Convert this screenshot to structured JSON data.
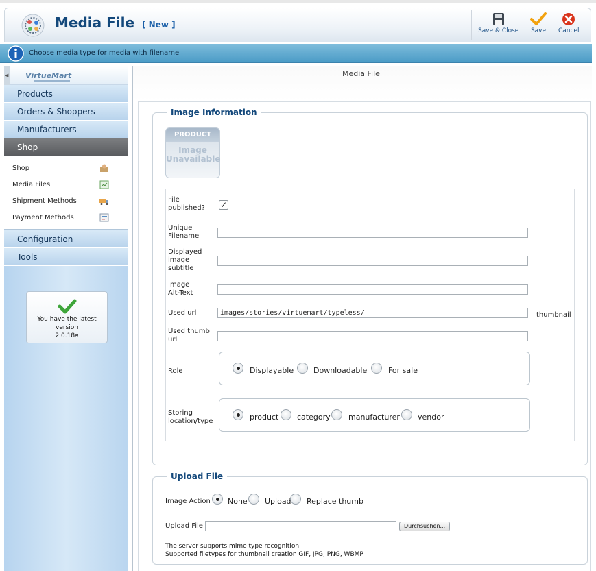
{
  "header": {
    "title": "Media File",
    "subtitle": "[ New ]",
    "toolbar": {
      "save_close": "Save & Close",
      "save": "Save",
      "cancel": "Cancel"
    }
  },
  "info": {
    "message": "Choose media type for media with filename"
  },
  "sidebar": {
    "brand": "VirtueMart",
    "items": [
      {
        "label": "Products"
      },
      {
        "label": "Orders & Shoppers"
      },
      {
        "label": "Manufacturers"
      },
      {
        "label": "Shop"
      }
    ],
    "subitems": [
      {
        "label": "Shop"
      },
      {
        "label": "Media Files"
      },
      {
        "label": "Shipment Methods"
      },
      {
        "label": "Payment Methods"
      }
    ],
    "items_after": [
      {
        "label": "Configuration"
      },
      {
        "label": "Tools"
      }
    ],
    "version": {
      "line1": "You have the latest",
      "line2": "version",
      "line3": "2.0.18a"
    }
  },
  "main": {
    "tab_label": "Media File",
    "image_info": {
      "legend": "Image Information",
      "placeholder_band": "PRODUCT",
      "placeholder_line1": "Image",
      "placeholder_line2": "Unavailable",
      "file_published_label_1": "File",
      "file_published_label_2": "published?",
      "file_published_checked": true,
      "unique_filename_label_1": "Unique",
      "unique_filename_label_2": "Filename",
      "unique_filename_value": "",
      "displayed_subtitle_label_1": "Displayed",
      "displayed_subtitle_label_2": "image",
      "displayed_subtitle_label_3": "subtitle",
      "displayed_subtitle_value": "",
      "alt_text_label_1": "Image",
      "alt_text_label_2": "Alt-Text",
      "alt_text_value": "",
      "used_url_label": "Used url",
      "used_url_value": "images/stories/virtuemart/typeless/",
      "used_url_suffix": "thumbnail",
      "used_thumb_url_label_1": "Used thumb",
      "used_thumb_url_label_2": "url",
      "used_thumb_url_value": "",
      "role_label": "Role",
      "role_options": [
        "Displayable",
        "Downloadable",
        "For sale"
      ],
      "role_selected": "Displayable",
      "storing_label_1": "Storing",
      "storing_label_2": "location/type",
      "storing_options": [
        "product",
        "category",
        "manufacturer",
        "vendor"
      ],
      "storing_selected": "product"
    },
    "upload": {
      "legend": "Upload File",
      "image_action_label": "Image Action",
      "image_action_options": [
        "None",
        "Upload",
        "Replace thumb"
      ],
      "image_action_selected": "None",
      "upload_file_label": "Upload File",
      "browse_label": "Durchsuchen...",
      "note1": "The server supports mime type recognition",
      "note2": "Supported filetypes for thumbnail creation GIF, JPG, PNG, WBMP"
    }
  }
}
